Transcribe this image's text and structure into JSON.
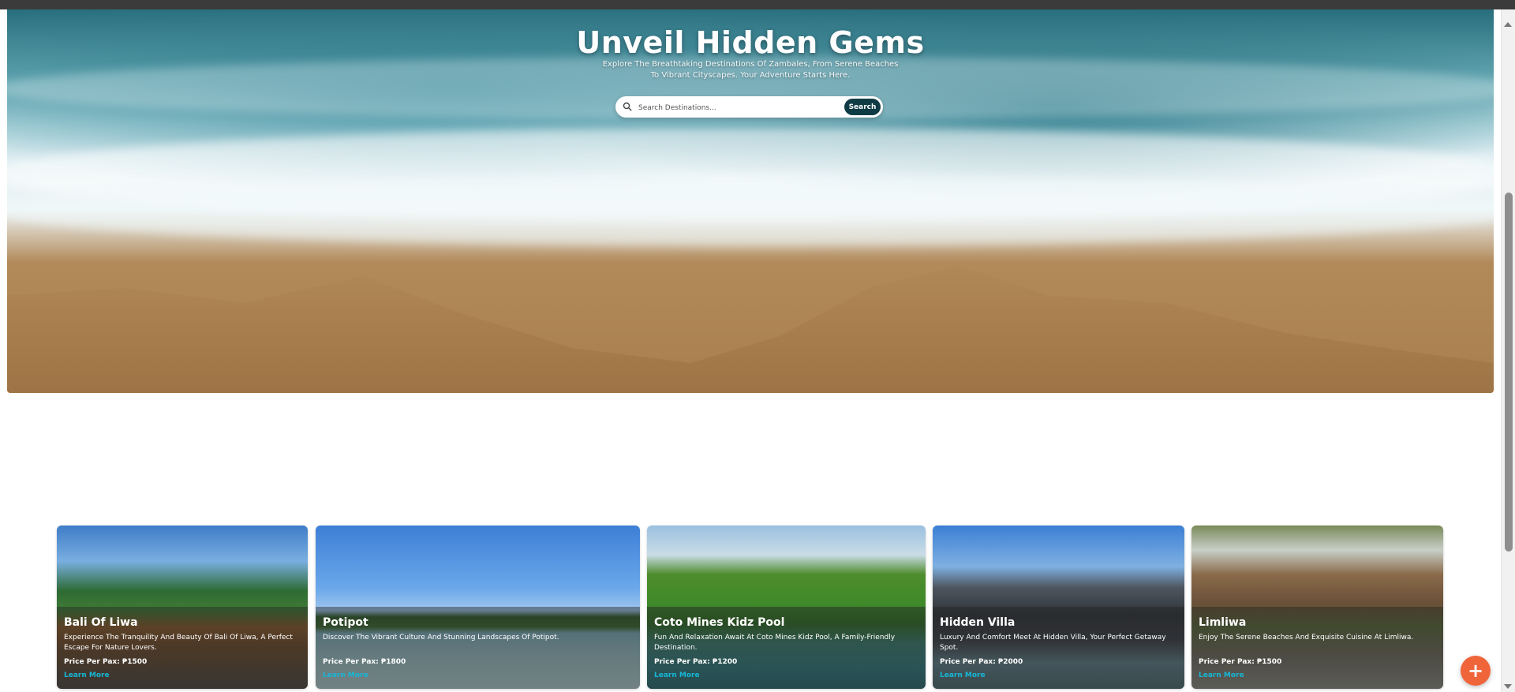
{
  "hero": {
    "title": "Unveil Hidden Gems",
    "subtitle": "Explore The Breathtaking Destinations Of Zambales, From Serene Beaches To Vibrant Cityscapes. Your Adventure Starts Here.",
    "search_placeholder": "Search Destinations...",
    "search_button": "Search",
    "search_icon": "search-icon"
  },
  "destinations": [
    {
      "name": "Bali Of Liwa",
      "description": "Experience The Tranquility And Beauty Of Bali Of Liwa, A Perfect Escape For Nature Lovers.",
      "price": "Price Per Pax: ₱1500",
      "link": "Learn More"
    },
    {
      "name": "Potipot",
      "description": "Discover The Vibrant Culture And Stunning Landscapes Of Potipot.",
      "price": "Price Per Pax: ₱1800",
      "link": "Learn More"
    },
    {
      "name": "Coto Mines Kidz Pool",
      "description": "Fun And Relaxation Await At Coto Mines Kidz Pool, A Family-Friendly Destination.",
      "price": "Price Per Pax: ₱1200",
      "link": "Learn More"
    },
    {
      "name": "Hidden Villa",
      "description": "Luxury And Comfort Meet At Hidden Villa, Your Perfect Getaway Spot.",
      "price": "Price Per Pax: ₱2000",
      "link": "Learn More"
    },
    {
      "name": "Limliwa",
      "description": "Enjoy The Serene Beaches And Exquisite Cuisine At Limliwa.",
      "price": "Price Per Pax: ₱1500",
      "link": "Learn More"
    }
  ],
  "fab": {
    "label": "+",
    "icon": "plus-icon",
    "color": "#f0643a"
  },
  "colors": {
    "search_button_bg": "#0f3b44",
    "link": "#16b7d6"
  }
}
